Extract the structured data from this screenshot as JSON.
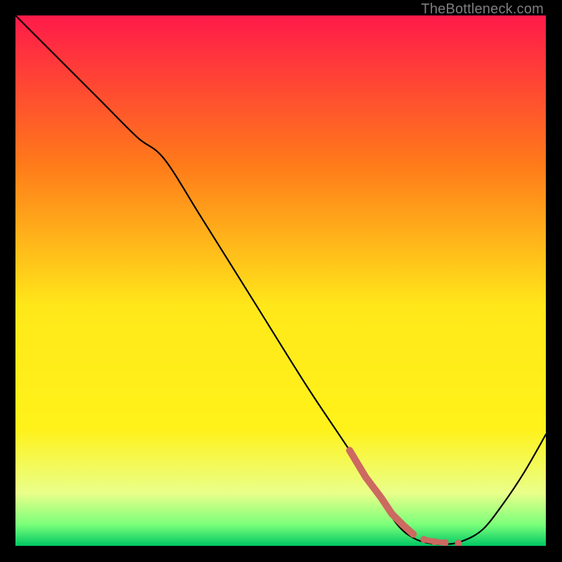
{
  "watermark": "TheBottleneck.com",
  "chart_data": {
    "type": "line",
    "title": "",
    "xlabel": "",
    "ylabel": "",
    "xlim": [
      0,
      100
    ],
    "ylim": [
      0,
      100
    ],
    "gradient_colors": {
      "top": "#ff1a4a",
      "upper_mid": "#ff9a1a",
      "mid": "#ffe81a",
      "lower_mid": "#d9ff8a",
      "low": "#7aff7a",
      "bottom": "#00c864"
    },
    "series": [
      {
        "name": "curve-black",
        "color": "#000000",
        "x": [
          0,
          8,
          16,
          23,
          28,
          35,
          45,
          55,
          63,
          68,
          72,
          75,
          78,
          81,
          84,
          88,
          92,
          96,
          100
        ],
        "y": [
          100,
          92,
          84,
          77,
          73,
          62,
          46,
          30,
          18,
          10,
          4,
          1.5,
          0.5,
          0.3,
          0.8,
          3,
          8,
          14,
          21
        ]
      },
      {
        "name": "marker-salmon",
        "color": "#cc6960",
        "x": [
          63,
          66,
          69,
          71,
          73,
          75,
          77,
          79,
          81,
          83.5
        ],
        "y": [
          18,
          13,
          9,
          6,
          4,
          2.2,
          1.2,
          0.8,
          0.6,
          0.5
        ]
      }
    ],
    "marker_style": {
      "start_linewidth": 10,
      "end_as_dots": true,
      "dot_radius": 5
    }
  }
}
